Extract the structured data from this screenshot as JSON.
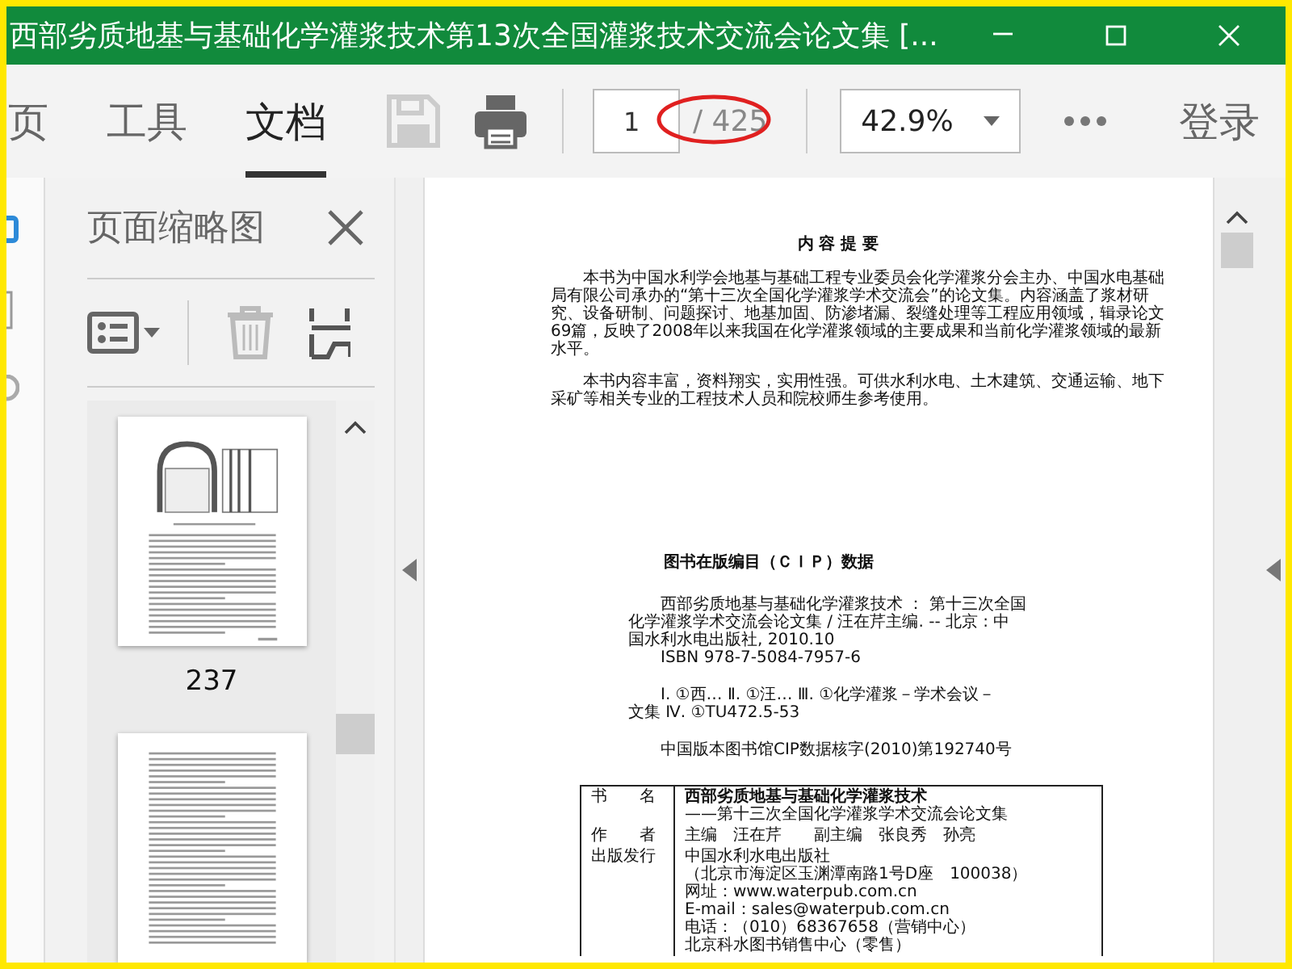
{
  "window": {
    "title": "西部劣质地基与基础化学灌浆技术第13次全国灌浆技术交流会论文集 [..."
  },
  "toolbar": {
    "tabs": [
      {
        "label": "页",
        "selected": false
      },
      {
        "label": "工具",
        "selected": false
      },
      {
        "label": "文档",
        "selected": true
      }
    ],
    "page_input": {
      "value": "1"
    },
    "page_total": "/ 425",
    "zoom": "42.9%",
    "login": "登录"
  },
  "thumbnail_panel": {
    "title": "页面缩略图",
    "thumbnails": [
      {
        "kind": "figure",
        "page_label": "237"
      },
      {
        "kind": "text"
      }
    ]
  },
  "document": {
    "abstract": {
      "heading": "内 容 提 要",
      "paragraphs": [
        [
          "本书为中国水利学会地基与基础工程专业委员会化学灌浆分会主办、中国水电基础",
          "局有限公司承办的“第十三次全国化学灌浆学术交流会”的论文集。内容涵盖了浆材研",
          "究、设备研制、问题探讨、地基加固、防渗堵漏、裂缝处理等工程应用领域，辑录论文",
          "69篇，反映了2008年以来我国在化学灌浆领域的主要成果和当前化学灌浆领域的最新",
          "水平。"
        ],
        [
          "本书内容丰富，资料翔实，实用性强。可供水利水电、土木建筑、交通运输、地下",
          "采矿等相关专业的工程技术人员和院校师生参考使用。"
        ]
      ]
    },
    "cip": {
      "heading": "图书在版编目（ＣＩＰ）数据",
      "lines": [
        {
          "kind": "first",
          "text": "西部劣质地基与基础化学灌浆技术 ： 第十三次全国"
        },
        {
          "kind": "continued",
          "text": "化学灌浆学术交流会论文集 / 汪在芹主编. -- 北京 : 中"
        },
        {
          "kind": "continued",
          "text": "国水利水电出版社, 2010.10"
        },
        {
          "kind": "first",
          "text": "ISBN 978-7-5084-7957-6"
        },
        {
          "kind": "gap_first",
          "text": "Ⅰ. ①西… Ⅱ. ①汪… Ⅲ. ①化学灌浆－学术会议－"
        },
        {
          "kind": "continued",
          "text": "文集 Ⅳ. ①TU472.5-53"
        },
        {
          "kind": "gap_first",
          "text": "中国版本图书馆CIP数据核字(2010)第192740号"
        }
      ]
    },
    "colophon": [
      {
        "label": "书　　名",
        "lines": [
          "西部劣质地基与基础化学灌浆技术",
          "——第十三次全国化学灌浆学术交流会论文集"
        ]
      },
      {
        "label": "作　　者",
        "lines": [
          "主编　汪在芹　　副主编　张良秀　孙亮"
        ]
      },
      {
        "label": "出版发行",
        "lines": [
          "中国水利水电出版社",
          "（北京市海淀区玉渊潭南路1号D座　100038）",
          "网址：www.waterpub.com.cn",
          "E-mail：sales@waterpub.com.cn",
          "电话：（010）68367658（营销中心）",
          "北京科水图书销售中心（零售）"
        ]
      }
    ]
  }
}
